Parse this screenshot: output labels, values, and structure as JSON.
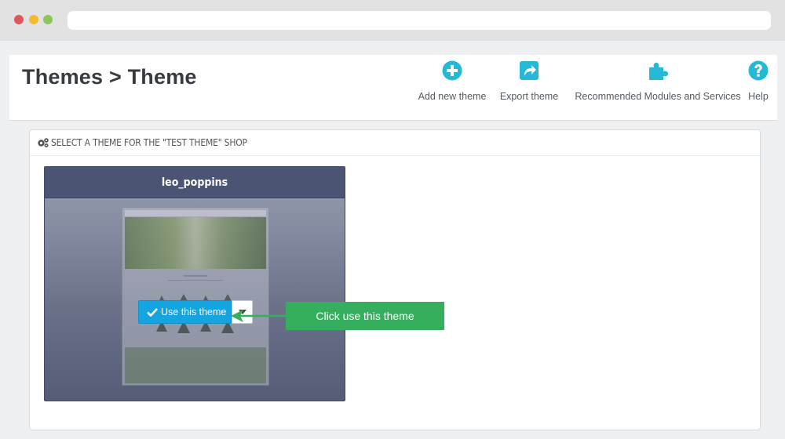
{
  "colors": {
    "accent": "#25b9d7",
    "use_button": "#14a4e0",
    "callout": "#35ae5e",
    "card_header": "#4b5573"
  },
  "header": {
    "title": "Themes > Theme",
    "toolbar": [
      {
        "label": "Add new theme",
        "icon": "plus-circle-icon"
      },
      {
        "label": "Export theme",
        "icon": "share-icon"
      },
      {
        "label": "Recommended Modules and Services",
        "icon": "puzzle-icon"
      },
      {
        "label": "Help",
        "icon": "question-circle-icon"
      }
    ]
  },
  "panel": {
    "heading": "SELECT A THEME FOR THE \"TEST THEME\" SHOP",
    "heading_icon": "gears-icon",
    "theme": {
      "name": "leo_poppins",
      "use_button_label": "Use this theme"
    }
  },
  "callout": {
    "text": "Click use this theme"
  }
}
